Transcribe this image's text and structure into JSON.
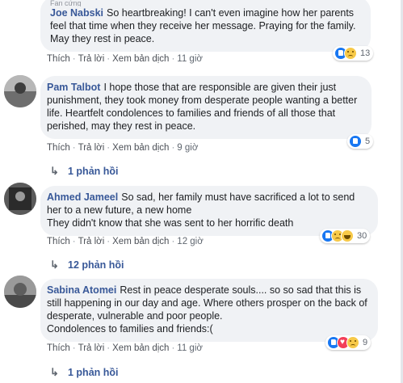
{
  "top_label": "Fan cứng",
  "actions": {
    "like": "Thích",
    "reply": "Trả lời",
    "translate": "Xem bản dịch",
    "sep": "·"
  },
  "comments": [
    {
      "author": "Joe Nabski",
      "text": "So heartbreaking! I can't even imagine how her parents feel that time when they receive her message. Praying for the family. May they rest in peace.",
      "time": "11 giờ",
      "reactions": [
        "like-icon",
        "sad-icon"
      ],
      "reaction_count": "13"
    },
    {
      "author": "Pam Talbot",
      "text": "I hope those that are responsible are given their just punishment, they took money from desperate people wanting a better life. Heartfelt condolences to families and friends of all those that perished, may they rest in peace.",
      "time": "9 giờ",
      "reactions": [
        "like-icon"
      ],
      "reaction_count": "5",
      "replies": "1 phản hồi"
    },
    {
      "author": "Ahmed Jameel",
      "text": "So sad, her family must have sacrificed a lot to send her to a new future, a new home\nThey didn't know that she was sent to her horrific death",
      "time": "12 giờ",
      "reactions": [
        "like-icon",
        "sad-icon",
        "haha-icon"
      ],
      "reaction_count": "30",
      "replies": "12 phản hồi"
    },
    {
      "author": "Sabina Atomei",
      "text": "Rest in peace desperate souls.... so so sad that this is still happening in our day and age. Where others prosper on the back of desperate, vulnerable and poor people.\nCondolences to families and friends:(",
      "time": "11 giờ",
      "reactions": [
        "like-icon",
        "love-icon",
        "sad-icon"
      ],
      "reaction_count": "9",
      "replies": "1 phản hồi"
    }
  ]
}
